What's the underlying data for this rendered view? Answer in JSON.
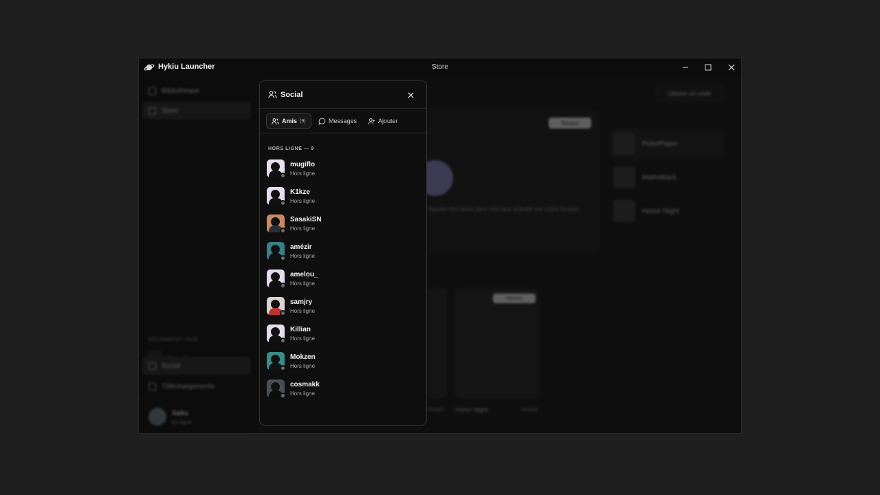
{
  "window": {
    "app_title": "Hykiu Launcher",
    "page_title": "Store"
  },
  "sidebar": {
    "items": [
      {
        "label": "Bibliothèque",
        "icon": "library-icon"
      },
      {
        "label": "Store",
        "icon": "store-icon"
      }
    ],
    "recent_section": "RÉCEMMENT JOUÉ",
    "recent_game": "PulsePaper",
    "bottom_items": [
      {
        "label": "Social",
        "icon": "users-icon"
      },
      {
        "label": "Téléchargements",
        "icon": "download-icon"
      }
    ],
    "user": {
      "name": "Saku",
      "status": "En ligne"
    }
  },
  "main": {
    "redeem_label": "Utiliser un code",
    "hero_badge": "Récent",
    "hero_text": "Ajouter des amis pour voir leur activité sur votre bureau",
    "recent_list": [
      "PulsePaper",
      "MathAttack",
      "Honor Night"
    ],
    "cards": [
      {
        "title": "",
        "price": "Gratuit",
        "badge": ""
      },
      {
        "title": "Honor Night",
        "price": "Gratuit",
        "badge": "Récent"
      }
    ]
  },
  "social": {
    "title": "Social",
    "tabs": [
      {
        "label": "Amis",
        "count": "(9)"
      },
      {
        "label": "Messages"
      },
      {
        "label": "Ajouter"
      }
    ],
    "section_label": "HORS LIGNE — 9",
    "friends": [
      {
        "name": "mugiflo",
        "status": "Hors ligne"
      },
      {
        "name": "K1kze",
        "status": "Hors ligne"
      },
      {
        "name": "SasakiSN",
        "status": "Hors ligne"
      },
      {
        "name": "amézir",
        "status": "Hors ligne"
      },
      {
        "name": "amelou_",
        "status": "Hors ligne"
      },
      {
        "name": "samjry",
        "status": "Hors ligne"
      },
      {
        "name": "Killian",
        "status": "Hors ligne"
      },
      {
        "name": "Mokzen",
        "status": "Hors ligne"
      },
      {
        "name": "cosmakk",
        "status": "Hors ligne"
      }
    ]
  },
  "colors": {
    "background": "#1f1f1f",
    "panel": "#0f0f0f",
    "offline_dot": "#6d6d6d",
    "online_dot": "#3fbf6a"
  }
}
